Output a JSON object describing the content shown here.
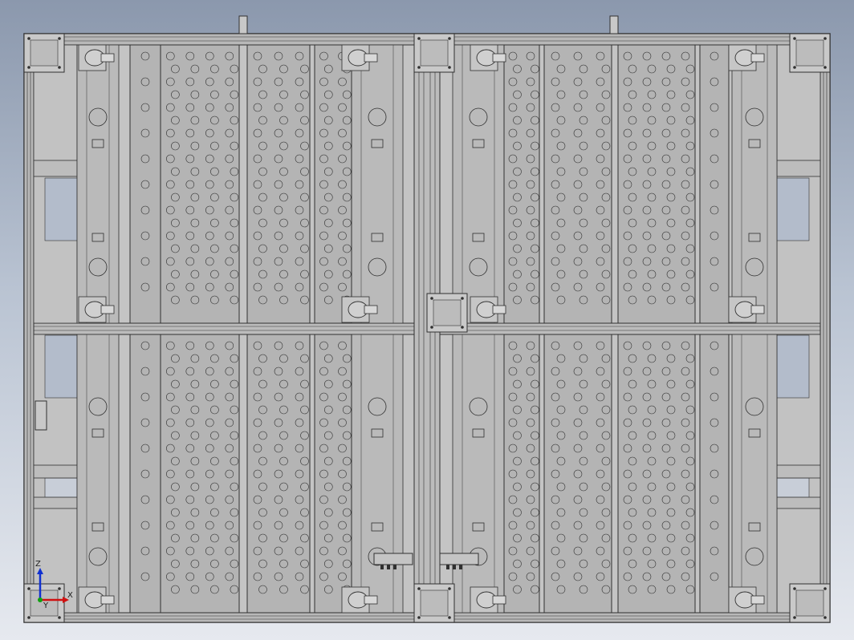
{
  "viewport": {
    "background_top": "#8b98ad",
    "background_bottom": "#e6e9ef",
    "metal_fill": "#bdbdbd",
    "panel_fill": "#b4b4b4",
    "line_color": "#303030"
  },
  "triad": {
    "x_label": "X",
    "y_label": "Y",
    "z_label": "Z",
    "x_color": "#d01010",
    "y_color": "#10a010",
    "z_color": "#1030d0"
  }
}
